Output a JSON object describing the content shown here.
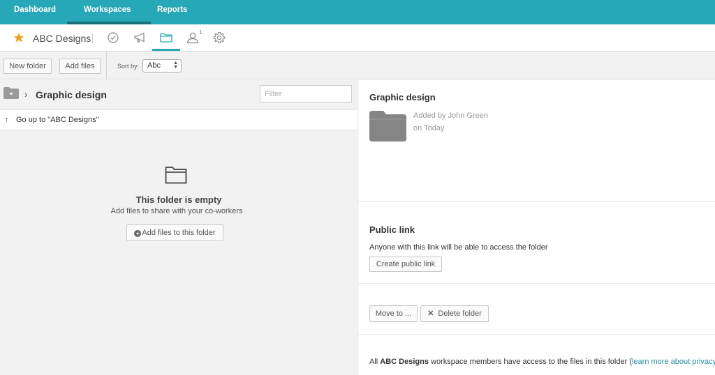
{
  "nav": {
    "items": [
      {
        "label": "Dashboard"
      },
      {
        "label": "Workspaces"
      },
      {
        "label": "Reports"
      }
    ]
  },
  "workspace": {
    "title": "ABC Designs",
    "members_badge": "1",
    "icons": [
      "check-circle-icon",
      "megaphone-icon",
      "folder-icon",
      "person-icon",
      "gear-icon"
    ]
  },
  "toolbar": {
    "new_folder": "New folder",
    "add_files": "Add files",
    "sort_label": "Sort by:",
    "sort_value": "Abc"
  },
  "left": {
    "breadcrumb_title": "Graphic design",
    "filter_placeholder": "Filter",
    "go_up": "Go up to \"ABC Designs\"",
    "empty_title": "This folder is empty",
    "empty_subtitle": "Add files to share with your co-workers",
    "add_files_button": "Add files to this folder"
  },
  "right": {
    "folder_title": "Graphic design",
    "added_by": "Added by John Green",
    "added_on": "on Today",
    "public_link_title": "Public link",
    "public_link_desc": "Anyone with this link will be able to access the folder",
    "create_link_button": "Create public link",
    "move_button": "Move to ...",
    "delete_button": "Delete folder",
    "footer": {
      "prefix": "All ",
      "workspace": "ABC Designs",
      "middle": " workspace members have access to the files in this folder (",
      "link": "learn more about privacy",
      "suffix": ")"
    }
  },
  "colors": {
    "brand": "#27a8b8",
    "star": "#f0a020",
    "folder_gray": "#858585"
  }
}
